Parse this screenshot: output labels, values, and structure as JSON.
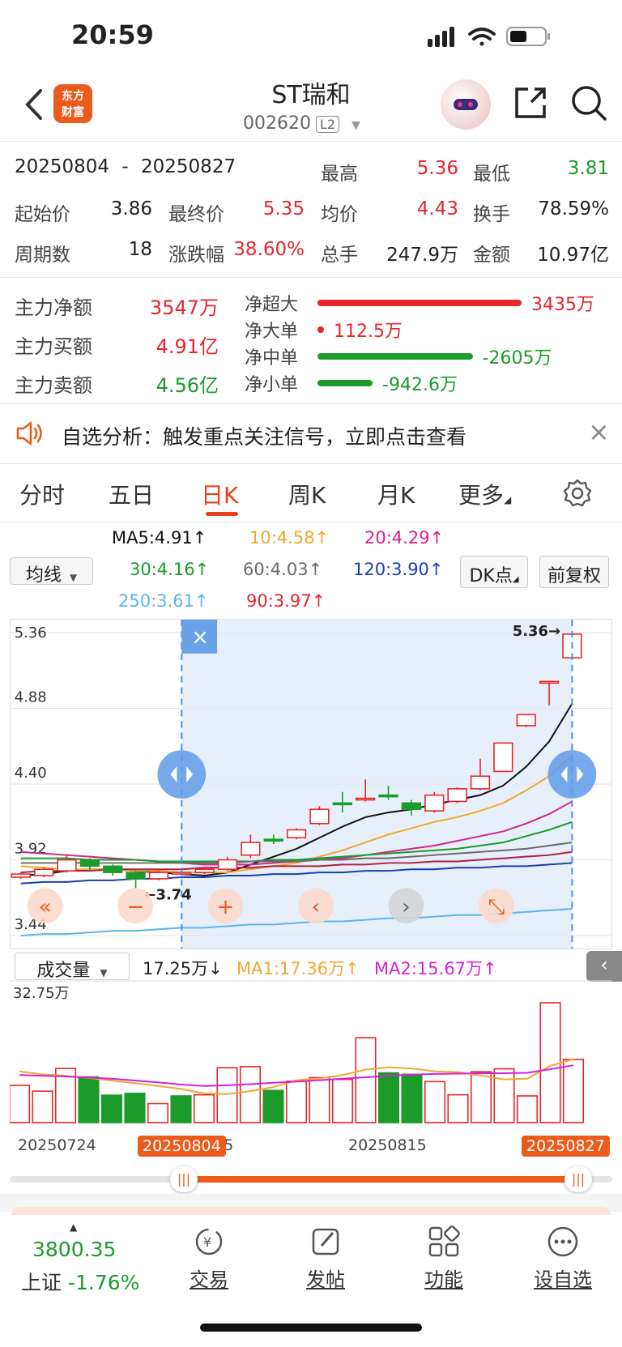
{
  "status": {
    "time": "20:59"
  },
  "nav": {
    "logo_text": "东方财富",
    "title": "ST瑞和",
    "code": "002620",
    "level": "L2"
  },
  "summary": {
    "range_start": "20250804",
    "range_sep": "-",
    "range_end": "20250827",
    "high_label": "最高",
    "high": "5.36",
    "low_label": "最低",
    "low": "3.81",
    "open_label": "起始价",
    "open": "3.86",
    "close_label": "最终价",
    "close": "5.35",
    "avg_label": "均价",
    "avg": "4.43",
    "turnover_label": "换手",
    "turnover": "78.59%",
    "periods_label": "周期数",
    "periods": "18",
    "change_label": "涨跌幅",
    "change": "38.60%",
    "vol_label": "总手",
    "vol": "247.9万",
    "amount_label": "金额",
    "amount": "10.97亿"
  },
  "flow": {
    "net_label": "主力净额",
    "net": "3547万",
    "buy_label": "主力买额",
    "buy": "4.91亿",
    "sell_label": "主力卖额",
    "sell": "4.56亿",
    "items": [
      {
        "label": "净超大",
        "value": "3435万",
        "fraction": 1.0,
        "color": "#e8252b"
      },
      {
        "label": "净大单",
        "value": "112.5万",
        "fraction": 0.03,
        "color": "#e8252b"
      },
      {
        "label": "净中单",
        "value": "-2605万",
        "fraction": 0.76,
        "color": "#1a9b2a"
      },
      {
        "label": "净小单",
        "value": "-942.6万",
        "fraction": 0.27,
        "color": "#1a9b2a"
      }
    ]
  },
  "notice": {
    "text": "自选分析：触发重点关注信号，立即点击查看",
    "close": "×"
  },
  "tabs": [
    "分时",
    "五日",
    "日K",
    "周K",
    "月K",
    "更多"
  ],
  "ma": {
    "selector": "均线",
    "ma5": "MA5:4.91",
    "ma10": "10:4.58",
    "ma20": "20:4.29",
    "ma30": "30:4.16",
    "ma60": "60:4.03",
    "ma120": "120:3.90",
    "ma250": "250:3.61",
    "ma90": "90:3.97",
    "dk_btn": "DK点",
    "fq_btn": "前复权",
    "arrow": "↑"
  },
  "chart_data": {
    "type": "candlestick",
    "y_ticks": [
      "5.36",
      "4.88",
      "4.40",
      "3.92",
      "3.44"
    ],
    "ylim": [
      3.44,
      5.36
    ],
    "high_marker": "5.36",
    "low_marker": "3.74",
    "candles": [
      {
        "o": 3.81,
        "c": 3.83,
        "h": 3.84,
        "l": 3.8
      },
      {
        "o": 3.82,
        "c": 3.86,
        "h": 3.87,
        "l": 3.81
      },
      {
        "o": 3.85,
        "c": 3.92,
        "h": 3.95,
        "l": 3.84
      },
      {
        "o": 3.92,
        "c": 3.88,
        "h": 3.93,
        "l": 3.85
      },
      {
        "o": 3.88,
        "c": 3.84,
        "h": 3.89,
        "l": 3.82
      },
      {
        "o": 3.84,
        "c": 3.8,
        "h": 3.85,
        "l": 3.74
      },
      {
        "o": 3.8,
        "c": 3.84,
        "h": 3.85,
        "l": 3.79
      },
      {
        "o": 3.83,
        "c": 3.84,
        "h": 3.85,
        "l": 3.82
      },
      {
        "o": 3.84,
        "c": 3.86,
        "h": 3.87,
        "l": 3.83
      },
      {
        "o": 3.86,
        "c": 3.92,
        "h": 3.94,
        "l": 3.85
      },
      {
        "o": 3.95,
        "c": 4.03,
        "h": 4.08,
        "l": 3.93
      },
      {
        "o": 4.05,
        "c": 4.04,
        "h": 4.08,
        "l": 4.02
      },
      {
        "o": 4.06,
        "c": 4.11,
        "h": 4.12,
        "l": 4.05
      },
      {
        "o": 4.15,
        "c": 4.24,
        "h": 4.26,
        "l": 4.14
      },
      {
        "o": 4.28,
        "c": 4.27,
        "h": 4.35,
        "l": 4.22
      },
      {
        "o": 4.31,
        "c": 4.31,
        "h": 4.43,
        "l": 4.29
      },
      {
        "o": 4.33,
        "c": 4.32,
        "h": 4.39,
        "l": 4.3
      },
      {
        "o": 4.28,
        "c": 4.24,
        "h": 4.3,
        "l": 4.2
      },
      {
        "o": 4.23,
        "c": 4.33,
        "h": 4.35,
        "l": 4.22
      },
      {
        "o": 4.29,
        "c": 4.37,
        "h": 4.38,
        "l": 4.28
      },
      {
        "o": 4.37,
        "c": 4.45,
        "h": 4.56,
        "l": 4.36
      },
      {
        "o": 4.48,
        "c": 4.66,
        "h": 4.66,
        "l": 4.48
      },
      {
        "o": 4.77,
        "c": 4.84,
        "h": 4.84,
        "l": 4.76
      },
      {
        "o": 5.05,
        "c": 5.05,
        "h": 5.05,
        "l": 4.9
      },
      {
        "o": 5.2,
        "c": 5.35,
        "h": 5.36,
        "l": 5.19
      }
    ],
    "ma_lines": [
      {
        "name": "MA5",
        "color": "#111111",
        "values": [
          3.82,
          3.83,
          3.85,
          3.86,
          3.86,
          3.85,
          3.84,
          3.83,
          3.82,
          3.84,
          3.89,
          3.94,
          3.99,
          4.06,
          4.13,
          4.19,
          4.22,
          4.24,
          4.27,
          4.3,
          4.33,
          4.39,
          4.51,
          4.67,
          4.91
        ]
      },
      {
        "name": "MA10",
        "color": "#f0a830",
        "values": [
          3.88,
          3.87,
          3.86,
          3.86,
          3.86,
          3.85,
          3.85,
          3.84,
          3.84,
          3.84,
          3.86,
          3.88,
          3.9,
          3.94,
          3.98,
          4.03,
          4.08,
          4.12,
          4.16,
          4.19,
          4.23,
          4.28,
          4.36,
          4.45,
          4.58
        ]
      },
      {
        "name": "MA20",
        "color": "#d6228a",
        "values": [
          3.97,
          3.96,
          3.95,
          3.94,
          3.93,
          3.92,
          3.91,
          3.9,
          3.89,
          3.89,
          3.89,
          3.9,
          3.91,
          3.92,
          3.93,
          3.95,
          3.97,
          3.99,
          4.01,
          4.04,
          4.07,
          4.1,
          4.15,
          4.21,
          4.29
        ]
      },
      {
        "name": "MA30",
        "color": "#1a9b2a",
        "values": [
          3.93,
          3.93,
          3.93,
          3.92,
          3.92,
          3.92,
          3.91,
          3.91,
          3.91,
          3.91,
          3.91,
          3.92,
          3.92,
          3.93,
          3.94,
          3.95,
          3.96,
          3.97,
          3.98,
          3.99,
          4.01,
          4.03,
          4.07,
          4.11,
          4.16
        ]
      },
      {
        "name": "MA60",
        "color": "#6a6a6a",
        "values": [
          3.9,
          3.9,
          3.9,
          3.9,
          3.9,
          3.9,
          3.9,
          3.9,
          3.9,
          3.9,
          3.91,
          3.91,
          3.91,
          3.92,
          3.92,
          3.93,
          3.93,
          3.94,
          3.95,
          3.96,
          3.97,
          3.98,
          3.99,
          4.01,
          4.03
        ]
      },
      {
        "name": "MA90",
        "color": "#b02040",
        "values": [
          3.84,
          3.85,
          3.85,
          3.85,
          3.86,
          3.86,
          3.86,
          3.86,
          3.87,
          3.87,
          3.87,
          3.88,
          3.88,
          3.88,
          3.89,
          3.89,
          3.9,
          3.9,
          3.91,
          3.91,
          3.92,
          3.93,
          3.94,
          3.95,
          3.97
        ]
      },
      {
        "name": "MA120",
        "color": "#1a3fb0",
        "values": [
          3.77,
          3.78,
          3.78,
          3.79,
          3.79,
          3.8,
          3.8,
          3.81,
          3.81,
          3.82,
          3.82,
          3.83,
          3.83,
          3.84,
          3.84,
          3.85,
          3.85,
          3.86,
          3.86,
          3.87,
          3.87,
          3.88,
          3.88,
          3.89,
          3.9
        ]
      },
      {
        "name": "MA250",
        "color": "#5ab4ef",
        "values": [
          3.44,
          3.45,
          3.45,
          3.46,
          3.47,
          3.47,
          3.48,
          3.49,
          3.49,
          3.5,
          3.51,
          3.51,
          3.52,
          3.53,
          3.53,
          3.54,
          3.55,
          3.55,
          3.56,
          3.57,
          3.57,
          3.58,
          3.59,
          3.6,
          3.61
        ]
      }
    ],
    "volume": {
      "label": "成交量",
      "current": "17.25万",
      "ma1": "MA1:17.36万",
      "ma2": "MA2:15.67万",
      "max_label": "32.75万",
      "ymax": 32.75,
      "bars": [
        {
          "v": 10.2,
          "up": true
        },
        {
          "v": 8.6,
          "up": true
        },
        {
          "v": 14.8,
          "up": true
        },
        {
          "v": 12.5,
          "up": false
        },
        {
          "v": 7.5,
          "up": false
        },
        {
          "v": 8.0,
          "up": false
        },
        {
          "v": 5.2,
          "up": true
        },
        {
          "v": 7.3,
          "up": false
        },
        {
          "v": 7.6,
          "up": true
        },
        {
          "v": 15.0,
          "up": true
        },
        {
          "v": 15.3,
          "up": true
        },
        {
          "v": 8.8,
          "up": false
        },
        {
          "v": 11.3,
          "up": true
        },
        {
          "v": 12.3,
          "up": true
        },
        {
          "v": 11.8,
          "up": true
        },
        {
          "v": 23.2,
          "up": true
        },
        {
          "v": 13.6,
          "up": false
        },
        {
          "v": 13.2,
          "up": false
        },
        {
          "v": 11.2,
          "up": true
        },
        {
          "v": 7.6,
          "up": true
        },
        {
          "v": 13.9,
          "up": true
        },
        {
          "v": 14.7,
          "up": true
        },
        {
          "v": 7.3,
          "up": true
        },
        {
          "v": 32.75,
          "up": true
        },
        {
          "v": 17.25,
          "up": true
        }
      ],
      "ma1_values": [
        14.0,
        13.2,
        12.8,
        12.2,
        11.5,
        10.8,
        10.0,
        9.2,
        8.0,
        7.8,
        8.6,
        9.7,
        11.6,
        12.1,
        13.0,
        14.5,
        15.1,
        14.8,
        14.0,
        13.8,
        12.9,
        11.8,
        12.0,
        15.5,
        17.36
      ],
      "ma2_values": [
        13.0,
        12.8,
        12.6,
        12.3,
        12.0,
        11.5,
        11.0,
        10.4,
        10.0,
        10.2,
        10.5,
        10.9,
        11.2,
        11.6,
        12.0,
        12.4,
        12.8,
        13.1,
        13.3,
        13.4,
        13.5,
        13.5,
        13.6,
        14.6,
        15.67
      ]
    },
    "dates": [
      "20250724",
      "20250804",
      "05",
      "20250815",
      "20250827"
    ]
  },
  "bottom": {
    "index_value": "3800.35",
    "index_name": "上证",
    "index_change": "-1.76%",
    "items": [
      "交易",
      "发帖",
      "功能",
      "设自选"
    ]
  }
}
